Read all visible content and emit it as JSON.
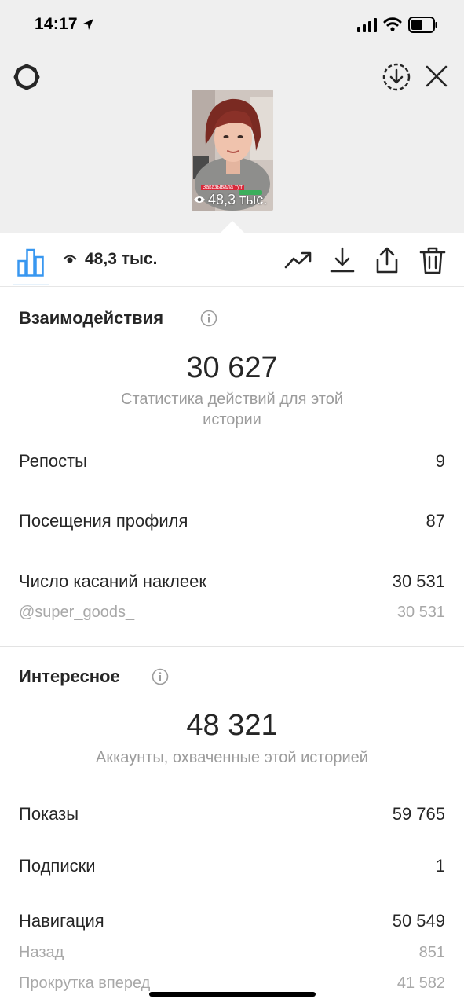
{
  "status_bar": {
    "time": "14:17"
  },
  "colors": {
    "accent": "#3897f0",
    "text": "#262626",
    "secondary_text": "#9c9c9c",
    "top_background": "#efefef"
  },
  "story_preview": {
    "sticker_text": "Заказывала тут",
    "views": "48,3 тыс."
  },
  "toolbar": {
    "views": "48,3 тыс.",
    "icons": [
      "bar-chart-icon",
      "eye-icon",
      "trend-icon",
      "download-icon",
      "share-icon",
      "trash-icon"
    ]
  },
  "interactions": {
    "title": "Взаимодействия",
    "total": "30 627",
    "caption": "Статистика действий для этой истории",
    "rows": [
      {
        "label": "Репосты",
        "value": "9"
      },
      {
        "label": "Посещения профиля",
        "value": "87"
      },
      {
        "label": "Число касаний наклеек",
        "value": "30 531"
      }
    ],
    "sub_rows": [
      {
        "label": "@super_goods_",
        "value": "30 531"
      }
    ]
  },
  "discovery": {
    "title": "Интересное",
    "total": "48 321",
    "caption": "Аккаунты, охваченные этой историей",
    "rows": [
      {
        "label": "Показы",
        "value": "59 765"
      },
      {
        "label": "Подписки",
        "value": "1"
      },
      {
        "label": "Навигация",
        "value": "50 549"
      }
    ],
    "sub_rows": [
      {
        "label": "Назад",
        "value": "851"
      },
      {
        "label": "Прокрутка вперед",
        "value": "41 582"
      }
    ]
  }
}
